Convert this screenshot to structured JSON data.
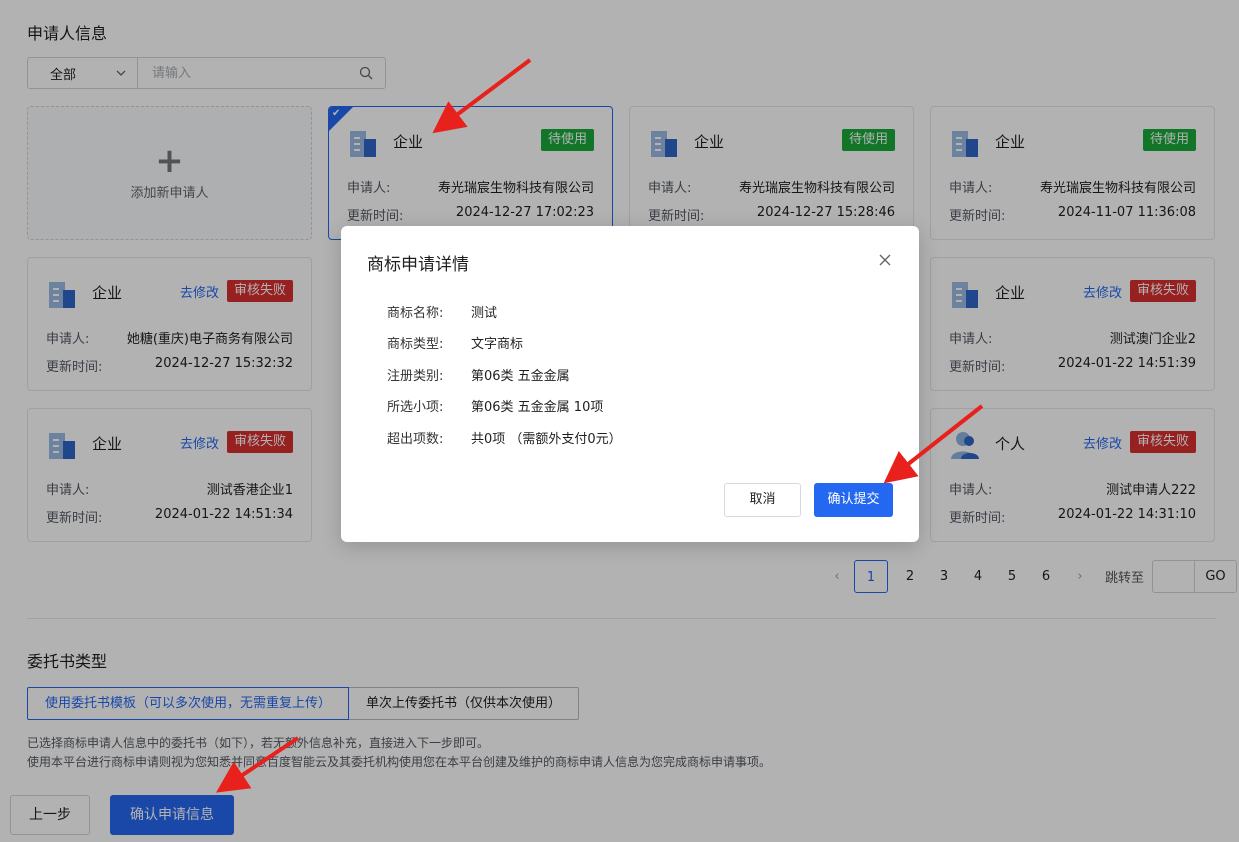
{
  "applicant_section": {
    "title": "申请人信息",
    "filter": {
      "selected": "全部",
      "placeholder": "请输入"
    },
    "add_card_label": "添加新申请人",
    "cards": [
      {
        "type": "企业",
        "status": "待使用",
        "status_kind": "green",
        "edit": "",
        "applicant_label": "申请人:",
        "applicant": "寿光瑞宸生物科技有限公司",
        "time_label": "更新时间:",
        "time": "2024-12-27 17:02:23",
        "selected": true,
        "icon": "building-icon"
      },
      {
        "type": "企业",
        "status": "待使用",
        "status_kind": "green",
        "edit": "",
        "applicant_label": "申请人:",
        "applicant": "寿光瑞宸生物科技有限公司",
        "time_label": "更新时间:",
        "time": "2024-12-27 15:28:46",
        "icon": "building-icon"
      },
      {
        "type": "企业",
        "status": "待使用",
        "status_kind": "green",
        "edit": "",
        "applicant_label": "申请人:",
        "applicant": "寿光瑞宸生物科技有限公司",
        "time_label": "更新时间:",
        "time": "2024-11-07 11:36:08",
        "icon": "building-icon"
      },
      {
        "type": "企业",
        "status": "审核失败",
        "status_kind": "red",
        "edit": "去修改",
        "applicant_label": "申请人:",
        "applicant": "她糖(重庆)电子商务有限公司",
        "time_label": "更新时间:",
        "time": "2024-12-27 15:32:32",
        "icon": "building-icon"
      },
      {
        "type": "企业",
        "status": "审核失败",
        "status_kind": "red",
        "edit": "去修改",
        "applicant_label": "申请人:",
        "applicant": "测试澳门企业2",
        "time_label": "更新时间:",
        "time": "2024-01-22 14:51:39",
        "icon": "building-icon"
      },
      {
        "type": "企业",
        "status": "审核失败",
        "status_kind": "red",
        "edit": "去修改",
        "applicant_label": "申请人:",
        "applicant": "测试香港企业1",
        "time_label": "更新时间:",
        "time": "2024-01-22 14:51:34",
        "icon": "building-icon"
      },
      {
        "type": "个人",
        "status": "审核失败",
        "status_kind": "red",
        "edit": "去修改",
        "applicant_label": "申请人:",
        "applicant": "测试申请人222",
        "time_label": "更新时间:",
        "time": "2024-01-22 14:31:10",
        "icon": "person-icon"
      }
    ],
    "pagination": {
      "pages": [
        "1",
        "2",
        "3",
        "4",
        "5",
        "6"
      ],
      "current": "1",
      "jump_label": "跳转至",
      "go_label": "GO"
    }
  },
  "power_of_attorney": {
    "title": "委托书类型",
    "tabs": [
      "使用委托书模板（可以多次使用，无需重复上传）",
      "单次上传委托书（仅供本次使用）"
    ],
    "note1": "已选择商标申请人信息中的委托书（如下），若无额外信息补充，直接进入下一步即可。",
    "note2": "使用本平台进行商标申请则视为您知悉并同意百度智能云及其委托机构使用您在本平台创建及维护的商标申请人信息为您完成商标申请事项。"
  },
  "footer": {
    "prev_label": "上一步",
    "confirm_label": "确认申请信息"
  },
  "modal": {
    "title": "商标申请详情",
    "rows": [
      {
        "k": "商标名称:",
        "v": "测试"
      },
      {
        "k": "商标类型:",
        "v": "文字商标"
      },
      {
        "k": "注册类别:",
        "v": "第06类 五金金属"
      },
      {
        "k": "所选小项:",
        "v": "第06类 五金金属 10项"
      },
      {
        "k": "超出项数:",
        "v": "共0项 （需额外支付0元）"
      }
    ],
    "cancel_label": "取消",
    "ok_label": "确认提交"
  },
  "colors": {
    "primary": "#2468f2",
    "success": "#1aaa3c",
    "danger": "#d92e2e",
    "annotation_arrow": "#e8211c"
  }
}
